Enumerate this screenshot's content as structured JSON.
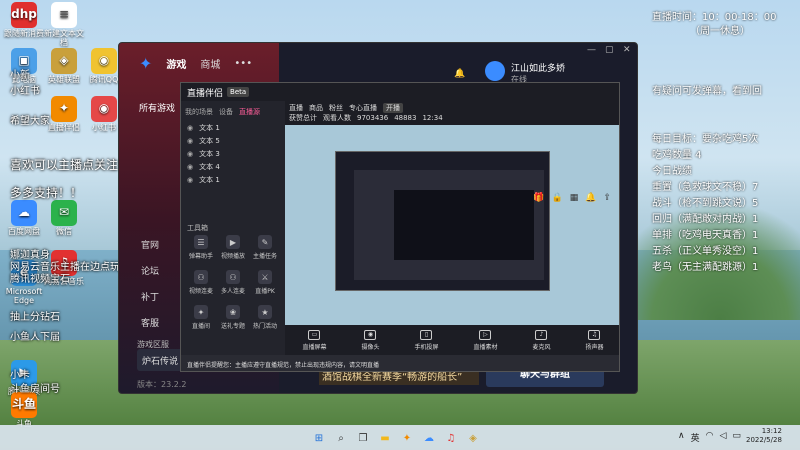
{
  "desktop": {
    "icons": [
      {
        "label": "跟随新消费",
        "glyph": "dhp",
        "color": "#e0302e"
      },
      {
        "label": "新建文本文档",
        "glyph": "≡",
        "color": "#ffffff"
      },
      {
        "label": "此电脑",
        "glyph": "▣",
        "color": "#4ca0e8"
      },
      {
        "label": "英雄联盟",
        "glyph": "◈",
        "color": "#c9a03b"
      },
      {
        "label": "腾讯QQ",
        "glyph": "◉",
        "color": "#f0c330"
      },
      {
        "label": "直播伴侣",
        "glyph": "✦",
        "color": "#f28a00"
      },
      {
        "label": "百度网盘",
        "glyph": "☁",
        "color": "#3b8cff"
      },
      {
        "label": "微信",
        "glyph": "✉",
        "color": "#2bb24c"
      },
      {
        "label": "小红书",
        "glyph": "◉",
        "color": "#e54848"
      },
      {
        "label": "Microsoft Edge",
        "glyph": "e",
        "color": "#2c8dd6"
      },
      {
        "label": "网易云音乐",
        "glyph": "♫",
        "color": "#e23131"
      },
      {
        "label": "腾讯视频",
        "glyph": "▶",
        "color": "#2c9ae8"
      },
      {
        "label": "斗鱼",
        "glyph": "斗鱼",
        "color": "#ff7a00"
      }
    ]
  },
  "overlay": {
    "left_lines": [
      "小新",
      "小红书",
      "希望大家",
      "喜欢可以主播点关注",
      "多多支持！！",
      "娜迦真身",
      "网易云音乐主播在边点玩",
      "腾讯视频宝石",
      "抽上分钻石",
      "小鱼人下届",
      "小卡",
      "斗鱼房间号"
    ],
    "right": {
      "stream_time": "直播时间：10：00-18：00",
      "rest_day": "（周一休息）",
      "qq_note": "有疑问可发弹幕，看到回",
      "goal_title": "每日目标：要杂吃鸡5次",
      "eat_count": "吃鸡数量   4",
      "tasks_title": "今日战绩",
      "tasks": [
        "重置（急救球文不稳）7",
        "战斗（枪不到跳文说）5",
        "回归（满配敢对内战）1",
        "单排（吃鸡电天真香）1",
        "五杀（正义单秀没空）1",
        "老鸟（无主满配跳源）1"
      ]
    }
  },
  "main_window": {
    "nav": {
      "tab_game": "游戏",
      "tab_shop": "商城",
      "more": "•••"
    },
    "user": {
      "name": "江山如此多娇",
      "status": "在线"
    },
    "controls": {
      "min": "—",
      "max": "▢",
      "close": "✕"
    },
    "all_service": "所有游戏",
    "side_links": [
      "官网",
      "论坛",
      "补丁",
      "客服"
    ],
    "region_label": "游戏区服",
    "region_value": "炉石传说",
    "version": "版本：23.2.2",
    "banner": "酒馆战棋全新赛季“畅游的船长”",
    "chat_button": "聊天与群组"
  },
  "stream_window": {
    "title": "直播伴侣",
    "badge": "Beta",
    "left_tabs": [
      "我的场景",
      "设备",
      "直播源"
    ],
    "scenes": [
      "文本 1",
      "文本 5",
      "文本 3",
      "文本 4",
      "文本 1"
    ],
    "tools_title": "工具箱",
    "tools": [
      {
        "label": "弹幕助手",
        "glyph": "☰"
      },
      {
        "label": "视频播放",
        "glyph": "▶"
      },
      {
        "label": "主播任务",
        "glyph": "✎"
      },
      {
        "label": "视频连麦",
        "glyph": "⚇"
      },
      {
        "label": "多人连麦",
        "glyph": "⚇"
      },
      {
        "label": "直播PK",
        "glyph": "⚔"
      },
      {
        "label": "直播间",
        "glyph": "✦"
      },
      {
        "label": "送礼专题",
        "glyph": "❀"
      },
      {
        "label": "热门活动",
        "glyph": "★"
      }
    ],
    "top": {
      "labels": [
        "直播",
        "商品",
        "粉丝",
        "专心直播"
      ],
      "pill": "开播",
      "row2": [
        "获赞总计",
        "观看人数",
        "12:34"
      ],
      "count": "9703436",
      "num2": "48883"
    },
    "bottom_controls": [
      "直播屏幕",
      "摄像头",
      "手机投屏",
      "直播素材",
      "麦克风",
      "扬声器"
    ],
    "notice": "直播伴侣提醒您：主播应遵守直播规范，禁止出现违规内容，请文明直播"
  },
  "taskbar": {
    "icons": [
      {
        "name": "windows-start",
        "glyph": "⊞",
        "color": "#1f6fd8"
      },
      {
        "name": "search",
        "glyph": "⌕",
        "color": "#333333"
      },
      {
        "name": "task-view",
        "glyph": "❐",
        "color": "#333333"
      },
      {
        "name": "file-explorer",
        "glyph": "▬",
        "color": "#f2b81c"
      },
      {
        "name": "douyin",
        "glyph": "✦",
        "color": "#f28a00"
      },
      {
        "name": "baidu",
        "glyph": "☁",
        "color": "#3b8cff"
      },
      {
        "name": "netease",
        "glyph": "♫",
        "color": "#e23131"
      },
      {
        "name": "game",
        "glyph": "◈",
        "color": "#c9a03b"
      }
    ],
    "tray": {
      "chevron": "∧",
      "lang": "英",
      "wifi": "◠",
      "volume": "◁",
      "battery": "▭"
    },
    "time": "13:12",
    "date": "2022/5/28"
  }
}
